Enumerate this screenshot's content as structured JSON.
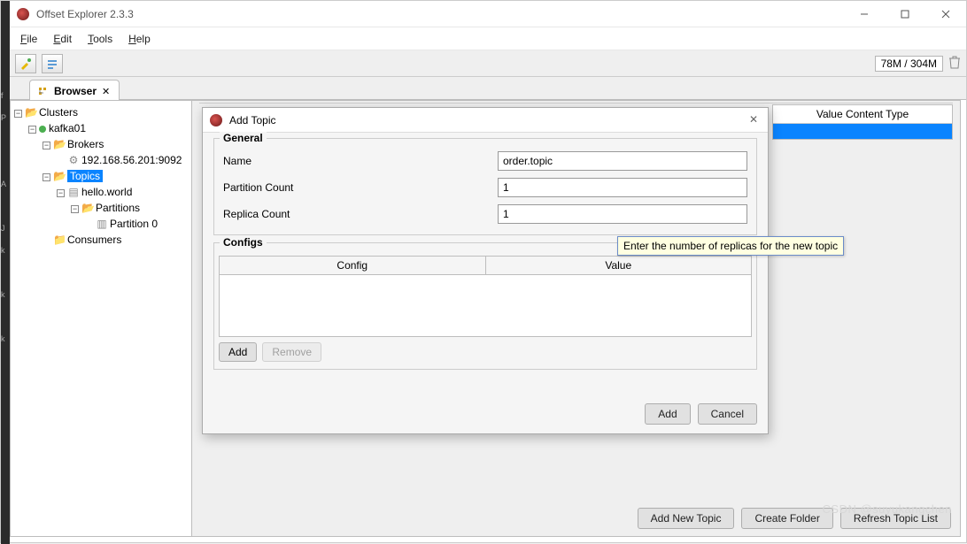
{
  "window": {
    "title": "Offset Explorer  2.3.3"
  },
  "menu": {
    "file": "File",
    "edit": "Edit",
    "tools": "Tools",
    "help": "Help"
  },
  "memory": "78M / 304M",
  "tab": {
    "label": "Browser"
  },
  "tree": {
    "root": "Clusters",
    "cluster": "kafka01",
    "brokers": "Brokers",
    "broker1": "192.168.56.201:9092",
    "topics": "Topics",
    "topic1": "hello.world",
    "partitions": "Partitions",
    "partition0": "Partition 0",
    "consumers": "Consumers"
  },
  "contentHeader": "Value Content Type",
  "bottomButtons": {
    "addNewTopic": "Add New Topic",
    "createFolder": "Create Folder",
    "refresh": "Refresh Topic List"
  },
  "dialog": {
    "title": "Add Topic",
    "generalLegend": "General",
    "nameLabel": "Name",
    "nameValue": "order.topic",
    "partitionLabel": "Partition Count",
    "partitionValue": "1",
    "replicaLabel": "Replica Count",
    "replicaValue": "1",
    "configsLegend": "Configs",
    "configCol": "Config",
    "valueCol": "Value",
    "addCfg": "Add",
    "removeCfg": "Remove",
    "addBtn": "Add",
    "cancelBtn": "Cancel"
  },
  "tooltip": "Enter the number of replicas for the new topic",
  "watermark": "CSDN @suyukangchen"
}
